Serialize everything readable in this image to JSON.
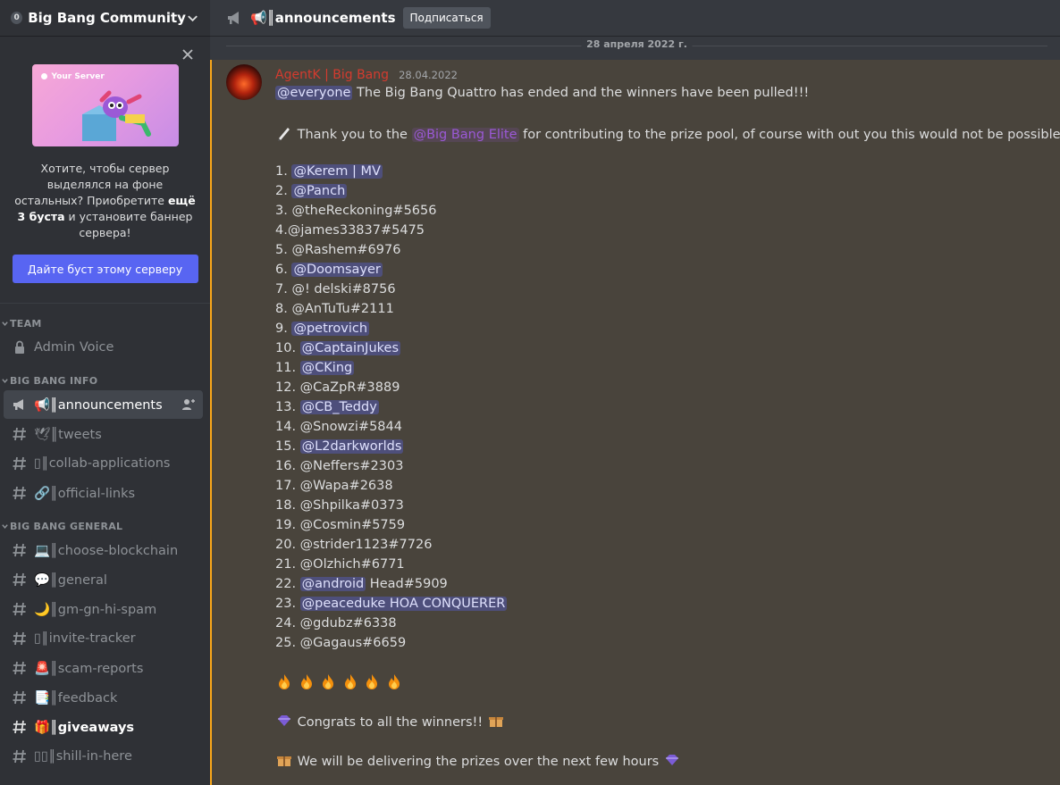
{
  "server": {
    "badge": "0",
    "name": "Big Bang Community"
  },
  "boost": {
    "banner_title": "Your Server",
    "text_before": "Хотите, чтобы сервер выделялся на фоне остальных? Приобретите ",
    "text_bold": "ещё 3 буста",
    "text_after": " и установите баннер сервера!",
    "button": "Дайте буст этому серверу"
  },
  "categories": {
    "team": "TEAM",
    "info": "BIG BANG INFO",
    "general": "BIG BANG GENERAL"
  },
  "channels": {
    "admin_voice": "Admin Voice",
    "announcements": "📢║announcements",
    "tweets": "🕊║tweets",
    "collab": "▯║collab-applications",
    "links": "🔗║official-links",
    "blockchain": "💻║choose-blockchain",
    "general": "💬║general",
    "gm": "🌙║gm-gn-hi-spam",
    "invite": "▯║invite-tracker",
    "scam": "🚨║scam-reports",
    "feedback": "📑║feedback",
    "giveaways": "🎁║giveaways",
    "shill": "▯▯║shill-in-here"
  },
  "header": {
    "title": "📢║announcements",
    "follow_button": "Подписаться"
  },
  "date_divider": "28 апреля 2022 г.",
  "message": {
    "author": "AgentK | Big Bang",
    "timestamp": "28.04.2022",
    "everyone": "@everyone",
    "intro": " The Big Bang Quattro has ended and the winners have been pulled!!!",
    "thanks_before": " Thank you to the ",
    "thanks_role": "@Big Bang Elite",
    "thanks_after": " for contributing to the prize pool, of course with out you this would not be possible ",
    "winners": [
      {
        "n": "1. ",
        "m": "@Kerem | MV",
        "t": ""
      },
      {
        "n": "2. ",
        "m": "@Panch",
        "t": ""
      },
      {
        "n": "3. @theReckoning#5656",
        "m": "",
        "t": ""
      },
      {
        "n": "4.@james33837#5475",
        "m": "",
        "t": ""
      },
      {
        "n": "5. @Rashem#6976",
        "m": "",
        "t": ""
      },
      {
        "n": "6. ",
        "m": "@Doomsayer",
        "t": ""
      },
      {
        "n": "7. @! delski#8756",
        "m": "",
        "t": ""
      },
      {
        "n": "8. @AnTuTu#2111",
        "m": "",
        "t": ""
      },
      {
        "n": "9. ",
        "m": "@petrovich",
        "t": ""
      },
      {
        "n": "10. ",
        "m": "@CaptainJukes",
        "t": ""
      },
      {
        "n": "11. ",
        "m": "@CKing",
        "t": ""
      },
      {
        "n": "12. @CaZpR#3889",
        "m": "",
        "t": ""
      },
      {
        "n": "13. ",
        "m": "@CB_Teddy",
        "t": ""
      },
      {
        "n": "14. @Snowzi#5844",
        "m": "",
        "t": ""
      },
      {
        "n": "15. ",
        "m": "@L2darkworlds",
        "t": ""
      },
      {
        "n": "16. @Neffers#2303",
        "m": "",
        "t": ""
      },
      {
        "n": "17. @Wapa#2638",
        "m": "",
        "t": ""
      },
      {
        "n": "18. @Shpilka#0373",
        "m": "",
        "t": ""
      },
      {
        "n": "19. @Cosmin#5759",
        "m": "",
        "t": ""
      },
      {
        "n": "20. @strider1123#7726",
        "m": "",
        "t": ""
      },
      {
        "n": "21. @Olzhich#6771",
        "m": "",
        "t": ""
      },
      {
        "n": "22. ",
        "m": "@android",
        "t": " Head#5909"
      },
      {
        "n": "23. ",
        "m": "@peaceduke HOA CONQUERER",
        "t": ""
      },
      {
        "n": "24. @gdubz#6338",
        "m": "",
        "t": ""
      },
      {
        "n": "25. @Gagaus#6659",
        "m": "",
        "t": ""
      }
    ],
    "congrats": " Congrats to all the winners!! ",
    "delivering": " We will be delivering the prizes over the next few hours "
  },
  "colors": {
    "accent": "#5865f2",
    "highlight_border": "#faa81a",
    "author": "#d43b2f"
  }
}
